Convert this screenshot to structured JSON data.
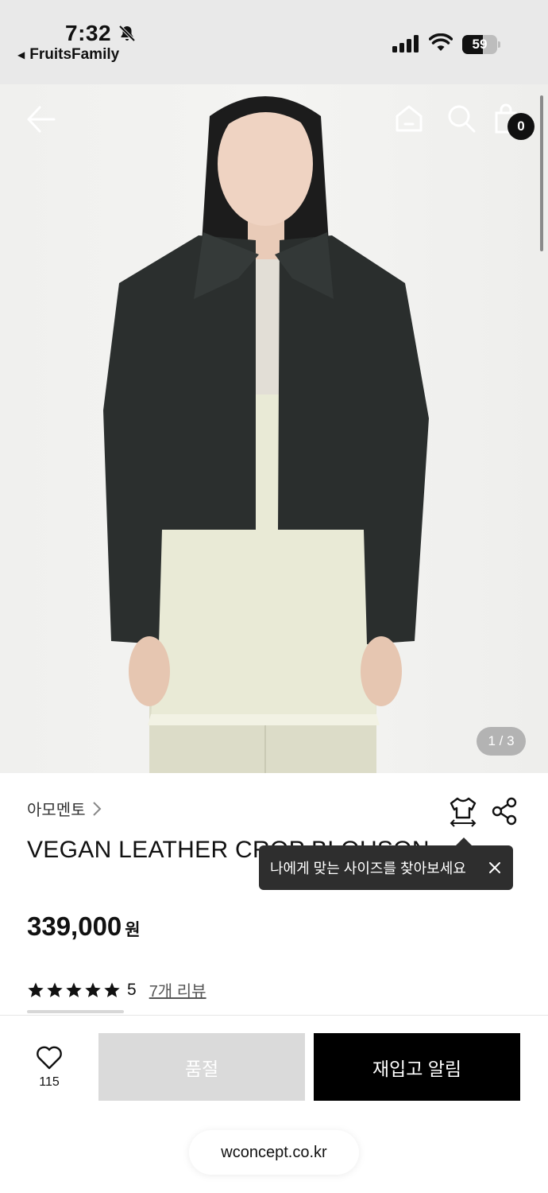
{
  "status_bar": {
    "time": "7:32",
    "back_app": "FruitsFamily",
    "battery": "59",
    "battery_level": 0.59
  },
  "icons": {
    "silent": "bell-slash-icon",
    "signal": "cellular-signal-icon",
    "wifi": "wifi-icon",
    "battery": "battery-icon",
    "back": "arrow-left-icon",
    "home": "home-icon",
    "search": "search-icon",
    "cart": "shopping-bag-icon",
    "brand_chevron": "chevron-right-icon",
    "size": "size-guide-shirt-icon",
    "share": "share-icon",
    "close": "close-icon",
    "star": "star-icon",
    "heart": "heart-icon"
  },
  "header": {
    "cart_count": "0"
  },
  "gallery": {
    "counter": "1 / 3"
  },
  "product": {
    "brand": "아모멘토",
    "title": "VEGAN LEATHER CROP BLOUSON",
    "price": "339,000",
    "price_unit": "원",
    "rating_score": "5",
    "rating_stars": 5,
    "review_link": "7개 리뷰"
  },
  "tooltip": {
    "text": "나에게 맞는 사이즈를 찾아보세요"
  },
  "bottom_bar": {
    "like_count": "115",
    "soldout_label": "품절",
    "restock_label": "재입고 알림"
  },
  "browser": {
    "url": "wconcept.co.kr"
  },
  "colors": {
    "primary_button": "#000000",
    "disabled_button": "#dadada",
    "tooltip_bg": "#2e2e2e",
    "badge_bg": "#111111"
  }
}
